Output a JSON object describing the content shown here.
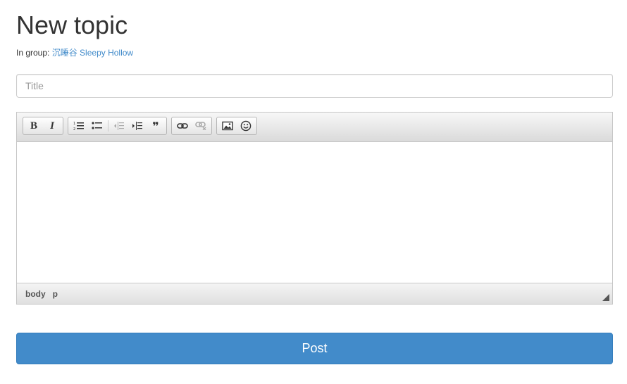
{
  "page": {
    "title": "New topic"
  },
  "group": {
    "prefix": "In group:",
    "name": "沉睡谷 Sleepy Hollow"
  },
  "title_field": {
    "placeholder": "Title",
    "value": ""
  },
  "editor": {
    "toolbar_groups": [
      [
        "bold-icon",
        "italic-icon"
      ],
      [
        "numbered-list-icon",
        "bulleted-list-icon",
        "decrease-indent-icon",
        "increase-indent-icon",
        "blockquote-icon"
      ],
      [
        "link-icon",
        "unlink-icon"
      ],
      [
        "image-icon",
        "smiley-icon"
      ]
    ],
    "bold_glyph": "B",
    "italic_glyph": "I",
    "quote_glyph": "❞",
    "status_path": [
      "body",
      "p"
    ]
  },
  "post_button": {
    "label": "Post"
  },
  "colors": {
    "accent": "#428bca",
    "link": "#428bca",
    "text": "#333333"
  }
}
